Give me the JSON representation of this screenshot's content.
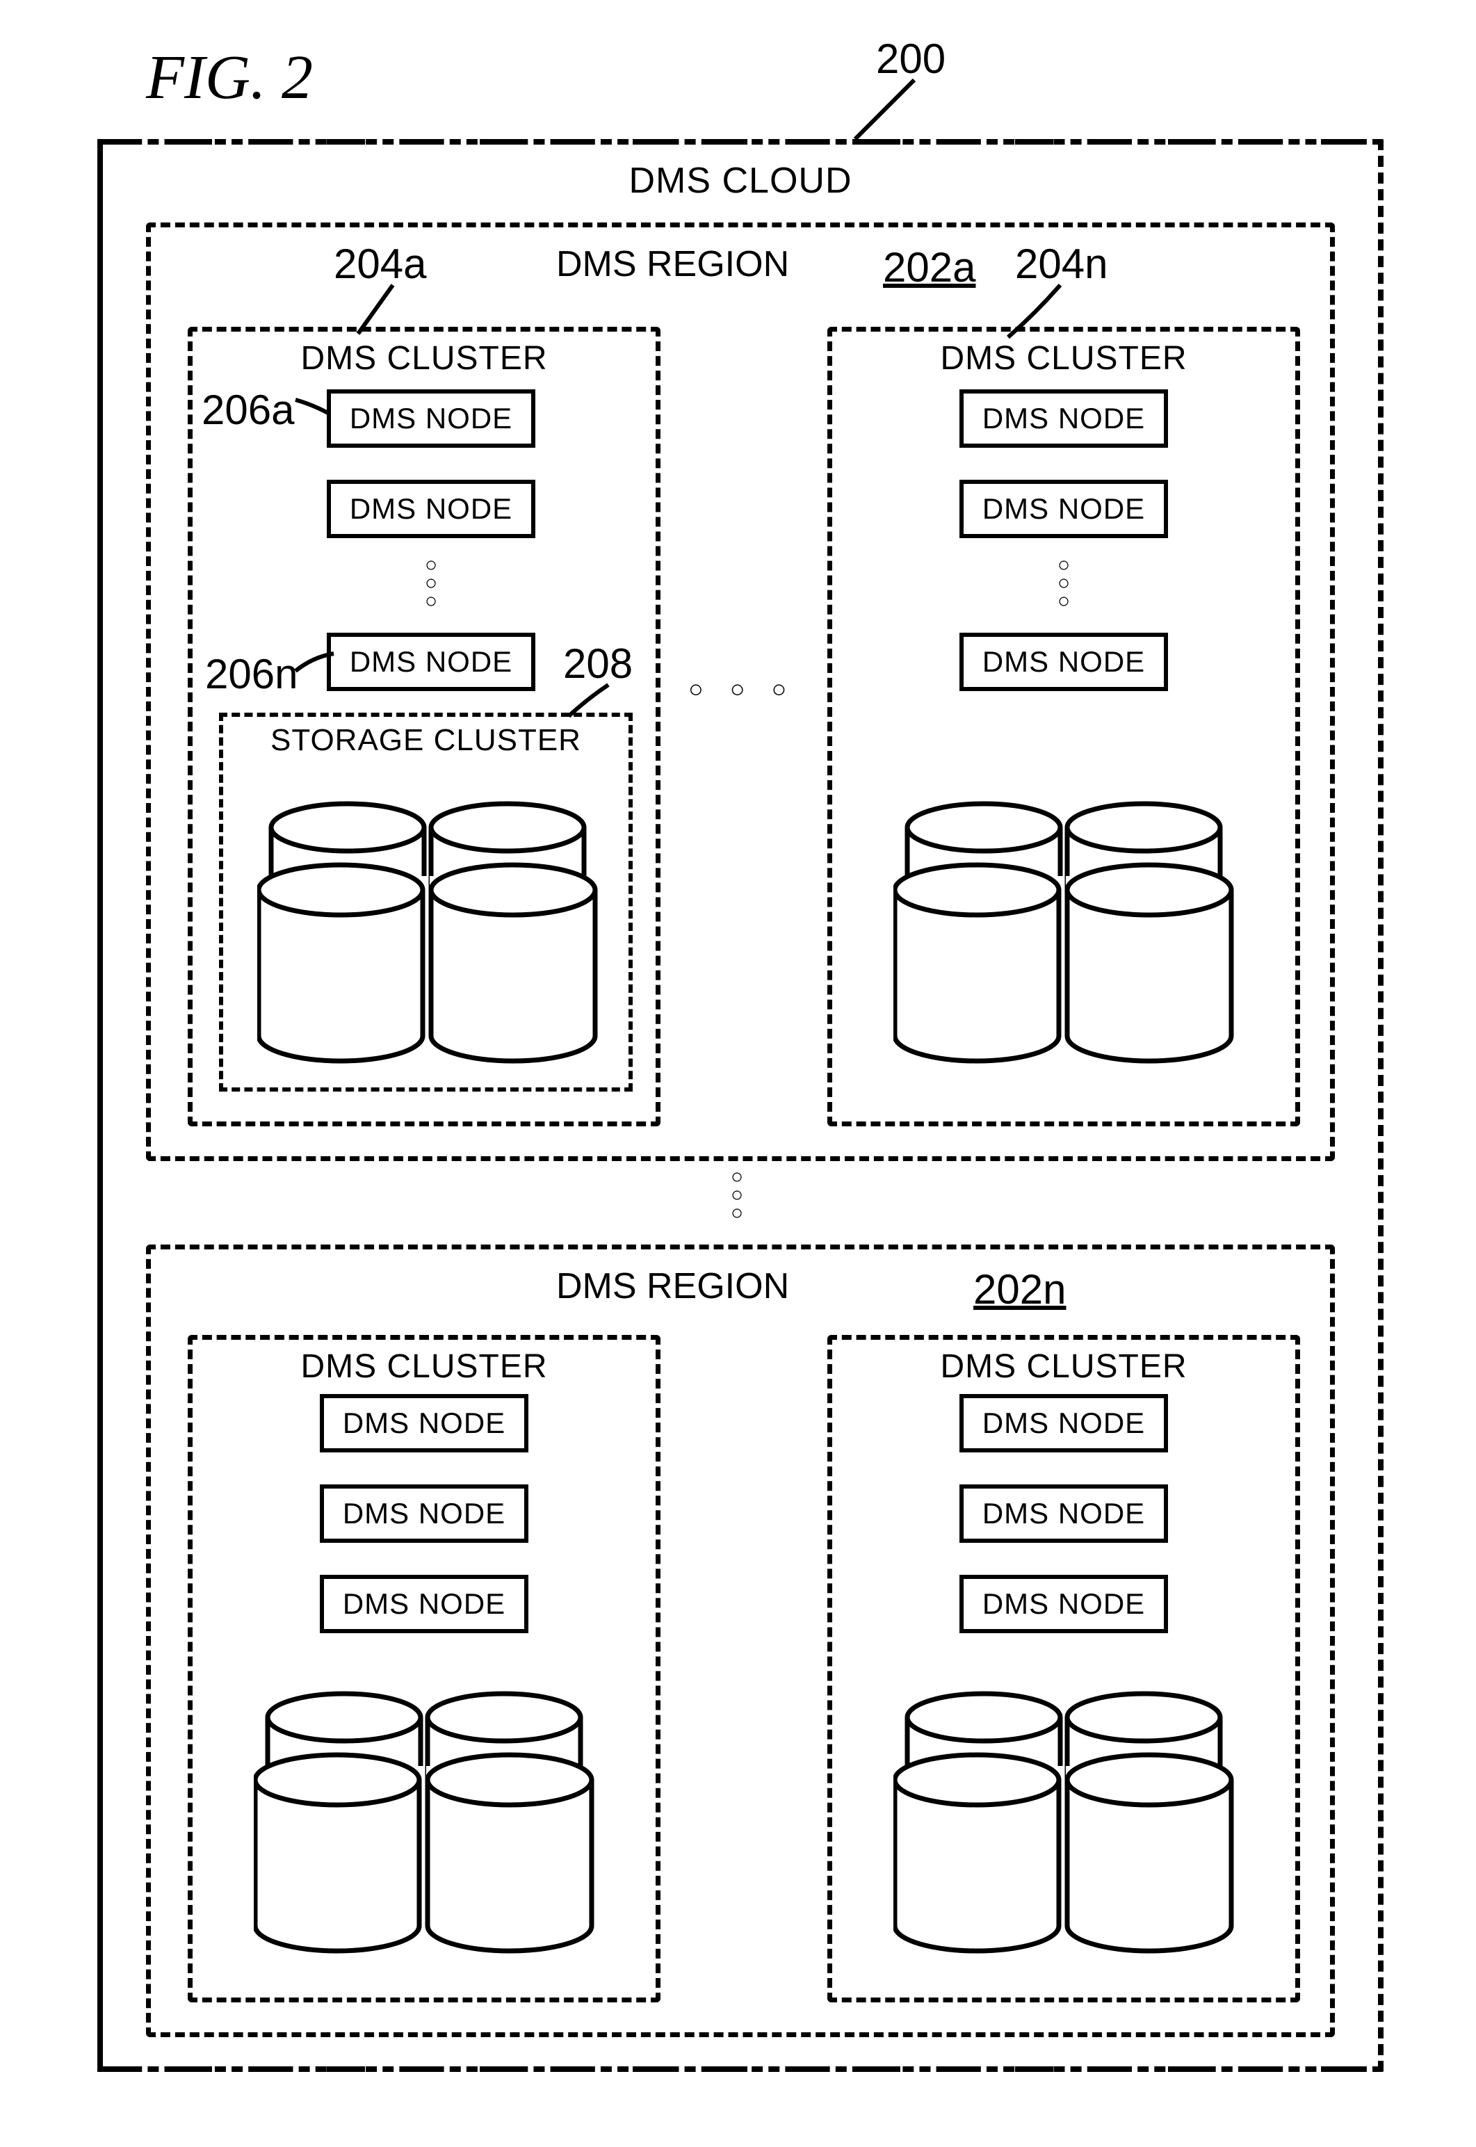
{
  "figure_label": "FIG. 2",
  "refs": {
    "r200": "200",
    "r202a": "202a",
    "r202n": "202n",
    "r204a": "204a",
    "r204n": "204n",
    "r206a": "206a",
    "r206n": "206n",
    "r208": "208"
  },
  "labels": {
    "cloud": "DMS CLOUD",
    "region": "DMS REGION",
    "cluster": "DMS CLUSTER",
    "node": "DMS NODE",
    "storage": "STORAGE CLUSTER"
  },
  "chart_data": {
    "type": "diagram",
    "title": "FIG. 2",
    "root": {
      "id": "200",
      "name": "DMS CLOUD",
      "children": [
        {
          "id": "202a",
          "name": "DMS REGION",
          "children": [
            {
              "id": "204a",
              "name": "DMS CLUSTER",
              "children": [
                {
                  "id": "206a",
                  "name": "DMS NODE"
                },
                {
                  "name": "DMS NODE"
                },
                {
                  "ellipsis": true
                },
                {
                  "id": "206n",
                  "name": "DMS NODE"
                },
                {
                  "id": "208",
                  "name": "STORAGE CLUSTER",
                  "type": "storage"
                }
              ]
            },
            {
              "ellipsis": true
            },
            {
              "id": "204n",
              "name": "DMS CLUSTER",
              "children": [
                {
                  "name": "DMS NODE"
                },
                {
                  "name": "DMS NODE"
                },
                {
                  "ellipsis": true
                },
                {
                  "name": "DMS NODE"
                },
                {
                  "type": "storage"
                }
              ]
            }
          ]
        },
        {
          "ellipsis": true
        },
        {
          "id": "202n",
          "name": "DMS REGION",
          "children": [
            {
              "name": "DMS CLUSTER",
              "children": [
                {
                  "name": "DMS NODE"
                },
                {
                  "name": "DMS NODE"
                },
                {
                  "name": "DMS NODE"
                },
                {
                  "type": "storage"
                }
              ]
            },
            {
              "name": "DMS CLUSTER",
              "children": [
                {
                  "name": "DMS NODE"
                },
                {
                  "name": "DMS NODE"
                },
                {
                  "name": "DMS NODE"
                },
                {
                  "type": "storage"
                }
              ]
            }
          ]
        }
      ]
    }
  }
}
